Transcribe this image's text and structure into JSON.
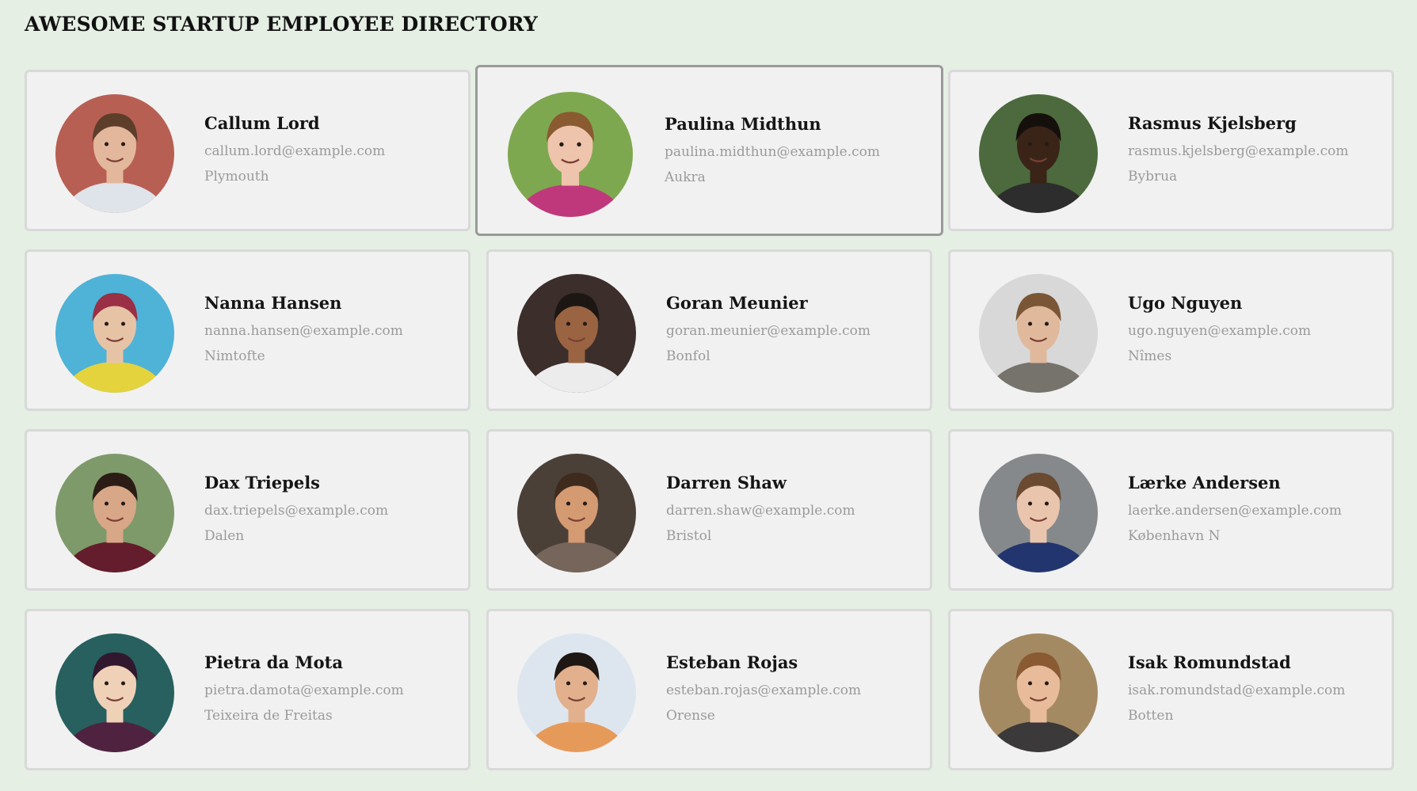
{
  "page": {
    "title": "AWESOME STARTUP EMPLOYEE DIRECTORY"
  },
  "employees": [
    {
      "name": "Callum Lord",
      "email": "callum.lord@example.com",
      "city": "Plymouth",
      "highlighted": false,
      "avatar": {
        "bg": "#b85f53",
        "skin": "#e3b79b",
        "hair": "#5d3e2b",
        "shirt": "#dfe3ea"
      }
    },
    {
      "name": "Paulina Midthun",
      "email": "paulina.midthun@example.com",
      "city": "Aukra",
      "highlighted": true,
      "avatar": {
        "bg": "#7ea84f",
        "skin": "#efc4ac",
        "hair": "#8a5a31",
        "shirt": "#c0387c"
      }
    },
    {
      "name": "Rasmus Kjelsberg",
      "email": "rasmus.kjelsberg@example.com",
      "city": "Bybrua",
      "highlighted": false,
      "avatar": {
        "bg": "#4c6a3d",
        "skin": "#3a2418",
        "hair": "#16100c",
        "shirt": "#2d2d2d"
      }
    },
    {
      "name": "Nanna Hansen",
      "email": "nanna.hansen@example.com",
      "city": "Nimtofte",
      "highlighted": false,
      "avatar": {
        "bg": "#4fb2d7",
        "skin": "#e7c3a6",
        "hair": "#9a2f45",
        "shirt": "#e4d33d"
      }
    },
    {
      "name": "Goran Meunier",
      "email": "goran.meunier@example.com",
      "city": "Bonfol",
      "highlighted": false,
      "avatar": {
        "bg": "#3c2e2b",
        "skin": "#9a6442",
        "hair": "#1d1714",
        "shirt": "#ececec"
      }
    },
    {
      "name": "Ugo Nguyen",
      "email": "ugo.nguyen@example.com",
      "city": "Nîmes",
      "highlighted": false,
      "avatar": {
        "bg": "#d8d8d8",
        "skin": "#e0b99c",
        "hair": "#7a5636",
        "shirt": "#76736c"
      }
    },
    {
      "name": "Dax Triepels",
      "email": "dax.triepels@example.com",
      "city": "Dalen",
      "highlighted": false,
      "avatar": {
        "bg": "#7e9a6a",
        "skin": "#d8a788",
        "hair": "#2b1d16",
        "shirt": "#641d2c"
      }
    },
    {
      "name": "Darren Shaw",
      "email": "darren.shaw@example.com",
      "city": "Bristol",
      "highlighted": false,
      "avatar": {
        "bg": "#4b4038",
        "skin": "#d49a72",
        "hair": "#3f2b1d",
        "shirt": "#76655b"
      }
    },
    {
      "name": "Lærke Andersen",
      "email": "laerke.andersen@example.com",
      "city": "København N",
      "highlighted": false,
      "avatar": {
        "bg": "#85898c",
        "skin": "#eac5ae",
        "hair": "#6a4a30",
        "shirt": "#23356e"
      }
    },
    {
      "name": "Pietra da Mota",
      "email": "pietra.damota@example.com",
      "city": "Teixeira de Freitas",
      "highlighted": false,
      "avatar": {
        "bg": "#27605e",
        "skin": "#efd1b8",
        "hair": "#31182f",
        "shirt": "#4f2340"
      }
    },
    {
      "name": "Esteban Rojas",
      "email": "esteban.rojas@example.com",
      "city": "Orense",
      "highlighted": false,
      "avatar": {
        "bg": "#dde6ee",
        "skin": "#e2b08d",
        "hair": "#1e1713",
        "shirt": "#e69a5a"
      }
    },
    {
      "name": "Isak Romundstad",
      "email": "isak.romundstad@example.com",
      "city": "Botten",
      "highlighted": false,
      "avatar": {
        "bg": "#a48a63",
        "skin": "#e8bc9b",
        "hair": "#8a5b33",
        "shirt": "#3b3939"
      }
    }
  ]
}
